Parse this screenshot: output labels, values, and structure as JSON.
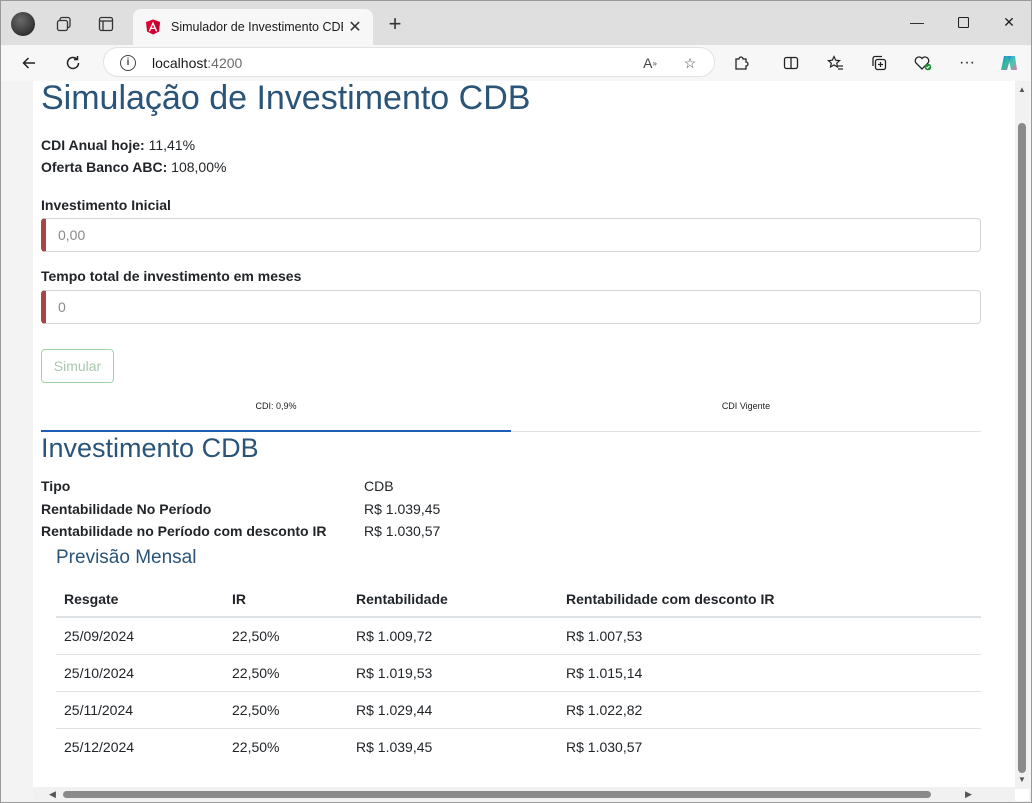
{
  "browser": {
    "tab_title": "Simulador de Investimento CDB",
    "url_host": "localhost",
    "url_port": ":4200"
  },
  "page": {
    "title": "Simulação de Investimento CDB",
    "cdi_label": "CDI Anual hoje:",
    "cdi_value": "11,41%",
    "offer_label": "Oferta Banco ABC:",
    "offer_value": "108,00%",
    "initial_label": "Investimento Inicial",
    "initial_placeholder": "0,00",
    "months_label": "Tempo total de investimento em meses",
    "months_placeholder": "0",
    "simulate_button": "Simular",
    "tabs": [
      "CDI: 0,9%",
      "CDI Vigente"
    ]
  },
  "result": {
    "section_title": "Investimento CDB",
    "rows": [
      {
        "label": "Tipo",
        "value": "CDB"
      },
      {
        "label": "Rentabilidade No Período",
        "value": "R$  1.039,45"
      },
      {
        "label": "Rentabilidade no Período com desconto IR",
        "value": "R$  1.030,57"
      }
    ],
    "forecast_title": "Previsão Mensal",
    "columns": [
      "Resgate",
      "IR",
      "Rentabilidade",
      "Rentabilidade com desconto IR"
    ],
    "table": [
      [
        "25/09/2024",
        "22,50%",
        "R$  1.009,72",
        "R$  1.007,53"
      ],
      [
        "25/10/2024",
        "22,50%",
        "R$  1.019,53",
        "R$  1.015,14"
      ],
      [
        "25/11/2024",
        "22,50%",
        "R$  1.029,44",
        "R$  1.022,82"
      ],
      [
        "25/12/2024",
        "22,50%",
        "R$  1.039,45",
        "R$  1.030,57"
      ]
    ]
  }
}
